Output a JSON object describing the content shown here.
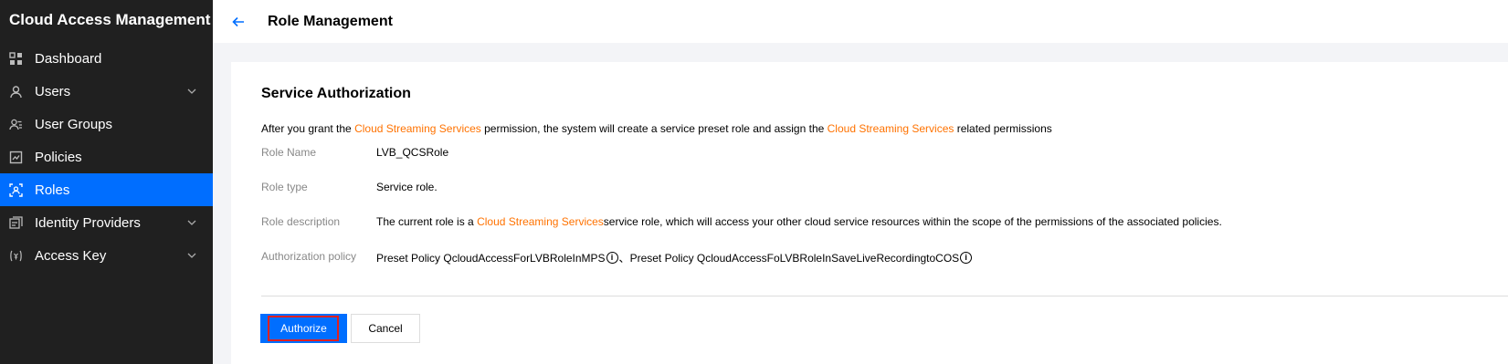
{
  "sidebar": {
    "title": "Cloud Access Management",
    "items": [
      {
        "label": "Dashboard",
        "icon": "dashboard-icon",
        "chevron": false,
        "active": false
      },
      {
        "label": "Users",
        "icon": "user-icon",
        "chevron": true,
        "active": false
      },
      {
        "label": "User Groups",
        "icon": "user-groups-icon",
        "chevron": false,
        "active": false
      },
      {
        "label": "Policies",
        "icon": "policy-icon",
        "chevron": false,
        "active": false
      },
      {
        "label": "Roles",
        "icon": "role-icon",
        "chevron": false,
        "active": true
      },
      {
        "label": "Identity Providers",
        "icon": "identity-provider-icon",
        "chevron": true,
        "active": false
      },
      {
        "label": "Access Key",
        "icon": "key-icon",
        "chevron": true,
        "active": false
      }
    ]
  },
  "header": {
    "back_icon": "arrow-left-icon",
    "title": "Role Management"
  },
  "card": {
    "title": "Service Authorization",
    "intro": {
      "part1": "After you grant the ",
      "service1": "Cloud Streaming Services",
      "part2": " permission, the system will create a service preset role and assign the ",
      "service2": "Cloud Streaming Services",
      "part3": " related permissions"
    },
    "role_name": {
      "label": "Role Name",
      "value": "LVB_QCSRole"
    },
    "role_type": {
      "label": "Role type",
      "value": "Service role."
    },
    "role_description": {
      "label": "Role description",
      "part1": "The current role is a ",
      "service": "Cloud Streaming Services",
      "part2": " service role, which will access your other cloud service resources within the scope of the permissions of the associated policies."
    },
    "authorization_policy": {
      "label": "Authorization policy",
      "policy1": "Preset Policy QcloudAccessForLVBRoleInMPS",
      "separator": "、",
      "policy2": "Preset Policy QcloudAccessFoLVBRoleInSaveLiveRecordingtoCOS",
      "info_glyph": "i"
    }
  },
  "actions": {
    "authorize_label": "Authorize",
    "cancel_label": "Cancel"
  },
  "colors": {
    "accent": "#006eff",
    "highlight": "#ff7200",
    "sidebar_bg": "#202020",
    "focus_outline": "#e02020"
  }
}
